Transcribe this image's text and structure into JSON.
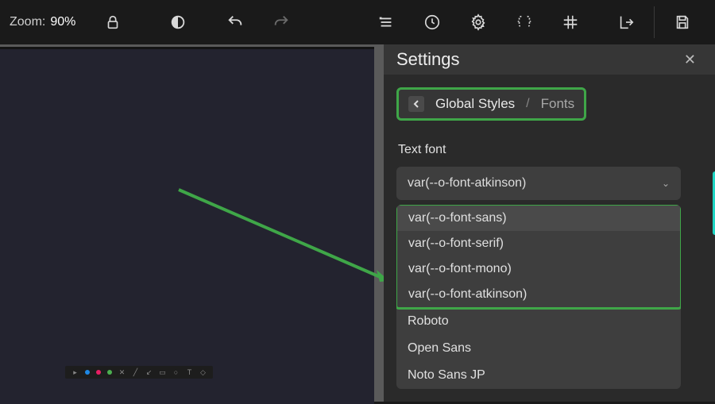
{
  "toolbar": {
    "zoom_label": "Zoom:",
    "zoom_value": "90%"
  },
  "annotation": {
    "highlight_color": "#3fa648",
    "dots": [
      "#1e88e5",
      "#e91e63",
      "#4caf50"
    ]
  },
  "settings": {
    "title": "Settings",
    "breadcrumb": {
      "parent": "Global Styles",
      "separator": "/",
      "current": "Fonts"
    },
    "text_font": {
      "label": "Text font",
      "selected": "var(--o-font-atkinson)",
      "highlighted_options": [
        "var(--o-font-sans)",
        "var(--o-font-serif)",
        "var(--o-font-mono)",
        "var(--o-font-atkinson)"
      ],
      "other_options": [
        "Roboto",
        "Open Sans",
        "Noto Sans JP"
      ]
    }
  }
}
